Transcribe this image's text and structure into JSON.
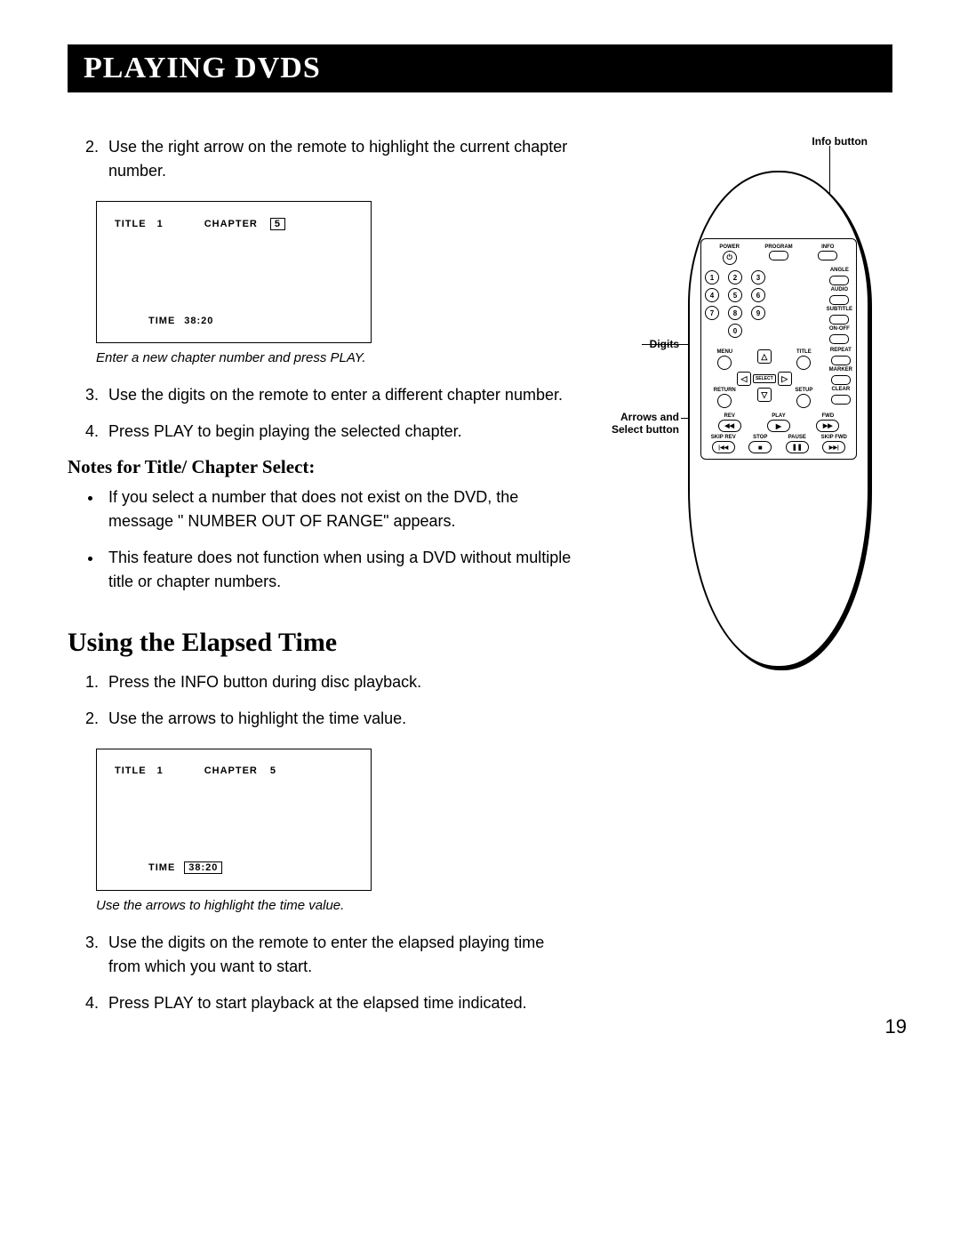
{
  "header": {
    "title": "PLAYING DVDS"
  },
  "steps_a": {
    "start": 2,
    "items": [
      "Use the right arrow on the remote to highlight the current chapter number."
    ]
  },
  "osd1": {
    "title_label": "TITLE",
    "title_value": "1",
    "chapter_label": "CHAPTER",
    "chapter_value": "5",
    "time_label": "TIME",
    "time_value": "38:20",
    "caption": "Enter a new chapter number and press PLAY."
  },
  "steps_b": {
    "start": 3,
    "items": [
      "Use the digits on the remote to enter a different chapter number.",
      "Press PLAY to begin playing the selected chapter."
    ]
  },
  "notes": {
    "heading": "Notes for Title/ Chapter Select:",
    "items": [
      "If you select a number that does not exist on the DVD, the message \" NUMBER OUT OF RANGE\"  appears.",
      "This feature does not function when using a DVD without multiple title or chapter numbers."
    ]
  },
  "section2": {
    "heading": "Using the Elapsed Time",
    "steps_c": {
      "start": 1,
      "items": [
        "Press the INFO button during disc playback.",
        "Use the arrows to highlight the time value."
      ]
    },
    "osd2": {
      "title_label": "TITLE",
      "title_value": "1",
      "chapter_label": "CHAPTER",
      "chapter_value": "5",
      "time_label": "TIME",
      "time_value": "38:20",
      "caption": "Use the arrows to highlight the time value."
    },
    "steps_d": {
      "start": 3,
      "items": [
        "Use the digits on the remote to enter the elapsed playing time from which you want to start.",
        "Press PLAY to start playback at the elapsed time indicated."
      ]
    }
  },
  "remote": {
    "callouts": {
      "info": "Info button",
      "digits": "Digits",
      "arrows": "Arrows and Select button"
    },
    "row1": {
      "power": "POWER",
      "program": "PROGRAM",
      "info": "INFO"
    },
    "digits": [
      "1",
      "2",
      "3",
      "4",
      "5",
      "6",
      "7",
      "8",
      "9",
      "0"
    ],
    "side_col": {
      "angle": "ANGLE",
      "audio": "AUDIO",
      "subtitle": "SUBTITLE",
      "onoff": "ON-OFF"
    },
    "nav_row1": {
      "menu": "MENU",
      "title": "TITLE",
      "repeat": "REPEAT"
    },
    "nav_row2": {
      "select": "SELECT",
      "marker": "MARKER"
    },
    "nav_row3": {
      "return": "RETURN",
      "setup": "SETUP",
      "clear": "CLEAR"
    },
    "play_row": {
      "rev": "REV",
      "play": "PLAY",
      "fwd": "FWD"
    },
    "transport": {
      "skiprev": "SKIP REV",
      "stop": "STOP",
      "pause": "PAUSE",
      "skipfwd": "SKIP FWD"
    },
    "glyphs": {
      "up": "△",
      "down": "▽",
      "left": "◁",
      "right": "▷",
      "rev": "◀◀",
      "play": "▶",
      "fwd": "▶▶",
      "skiprev": "|◀◀",
      "stop": "■",
      "pause": "❚❚",
      "skipfwd": "▶▶|",
      "power": "⏻"
    }
  },
  "page_number": "19"
}
